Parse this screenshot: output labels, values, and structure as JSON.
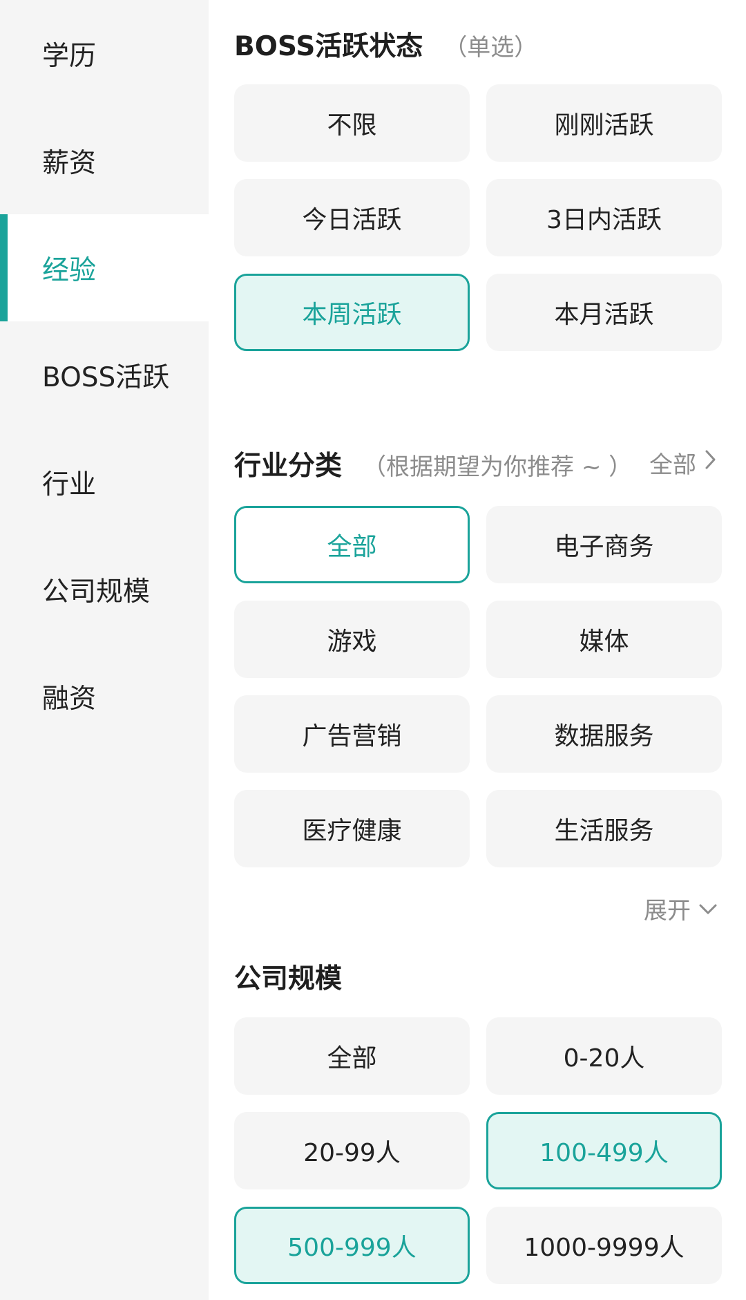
{
  "sidebar": {
    "items": [
      {
        "label": "学历"
      },
      {
        "label": "薪资"
      },
      {
        "label": "经验"
      },
      {
        "label": "BOSS活跃"
      },
      {
        "label": "行业"
      },
      {
        "label": "公司规模"
      },
      {
        "label": "融资"
      }
    ],
    "active_index": 2
  },
  "boss_status": {
    "title": "BOSS活跃状态",
    "subtitle": "（单选）",
    "options": [
      {
        "label": "不限"
      },
      {
        "label": "刚刚活跃"
      },
      {
        "label": "今日活跃"
      },
      {
        "label": "3日内活跃"
      },
      {
        "label": "本周活跃"
      },
      {
        "label": "本月活跃"
      }
    ]
  },
  "industry": {
    "title": "行业分类",
    "subtitle": "（根据期望为你推荐 ~ ）",
    "all_link": "全部",
    "expand_label": "展开",
    "options": [
      {
        "label": "全部"
      },
      {
        "label": "电子商务"
      },
      {
        "label": "游戏"
      },
      {
        "label": "媒体"
      },
      {
        "label": "广告营销"
      },
      {
        "label": "数据服务"
      },
      {
        "label": "医疗健康"
      },
      {
        "label": "生活服务"
      }
    ]
  },
  "company_size": {
    "title": "公司规模",
    "options": [
      {
        "label": "全部"
      },
      {
        "label": "0-20人"
      },
      {
        "label": "20-99人"
      },
      {
        "label": "100-499人"
      },
      {
        "label": "500-999人"
      },
      {
        "label": "1000-9999人"
      }
    ]
  },
  "colors": {
    "accent": "#1aa39a",
    "selected_bg": "#e3f6f3",
    "chip_bg": "#f5f5f5",
    "sidebar_bg": "#f5f5f5",
    "muted_text": "#8c8c8c"
  },
  "icons": {
    "all_link_icon": "chevron-right-icon",
    "expand_icon": "chevron-down-icon"
  }
}
